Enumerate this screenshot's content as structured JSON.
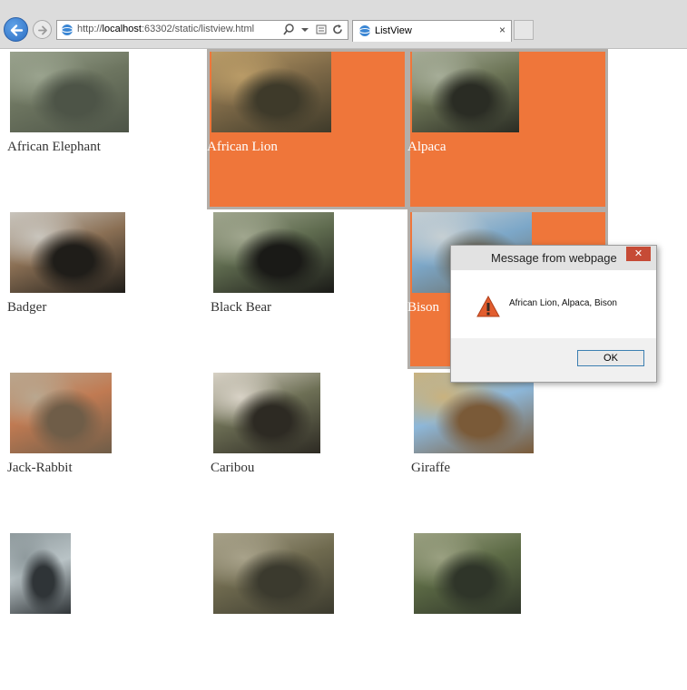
{
  "browser": {
    "url_prefix": "http://",
    "url_host": "localhost",
    "url_rest": ":63302/static/listview.html",
    "tab_title": "ListView",
    "tab_close_glyph": "×"
  },
  "animals": [
    {
      "name": "African Elephant",
      "selected": false,
      "colors": [
        "#6d7560",
        "#4d5447",
        "#9aa38e"
      ]
    },
    {
      "name": "African Lion",
      "selected": true,
      "colors": [
        "#7f6a48",
        "#3e3a2a",
        "#b99b67"
      ]
    },
    {
      "name": "Alpaca",
      "selected": true,
      "colors": [
        "#6c7456",
        "#2a2c24",
        "#a6ad98"
      ]
    },
    {
      "name": "Badger",
      "selected": false,
      "colors": [
        "#8a6f54",
        "#1f1d19",
        "#c9c5bd"
      ]
    },
    {
      "name": "Black Bear",
      "selected": false,
      "colors": [
        "#5f6b4f",
        "#1a1a17",
        "#a0a68e"
      ]
    },
    {
      "name": "Bison",
      "selected": true,
      "colors": [
        "#7ca7c8",
        "#6b6a60",
        "#c6cfd3"
      ]
    },
    {
      "name": "Jack-Rabbit",
      "selected": false,
      "colors": [
        "#c07a52",
        "#6f5d48",
        "#b9a78f"
      ]
    },
    {
      "name": "Caribou",
      "selected": false,
      "colors": [
        "#6d6f55",
        "#2d2a23",
        "#d8d2c6"
      ]
    },
    {
      "name": "Giraffe",
      "selected": false,
      "colors": [
        "#8db7d9",
        "#7a5a38",
        "#c9b27e"
      ]
    },
    {
      "name": "",
      "selected": false,
      "colors": [
        "#b9c3c6",
        "#2f3437",
        "#8f9a9d"
      ]
    },
    {
      "name": "",
      "selected": false,
      "colors": [
        "#6f6a4f",
        "#3b3a2e",
        "#a8a28a"
      ]
    },
    {
      "name": "",
      "selected": false,
      "colors": [
        "#5c6a45",
        "#2f3529",
        "#9aa081"
      ]
    }
  ],
  "dialog": {
    "title": "Message from webpage",
    "close_glyph": "✕",
    "message": "African Lion, Alpaca, Bison",
    "ok_label": "OK"
  },
  "colors": {
    "selection": "#ef763a",
    "selection_border": "#b3aea9"
  }
}
